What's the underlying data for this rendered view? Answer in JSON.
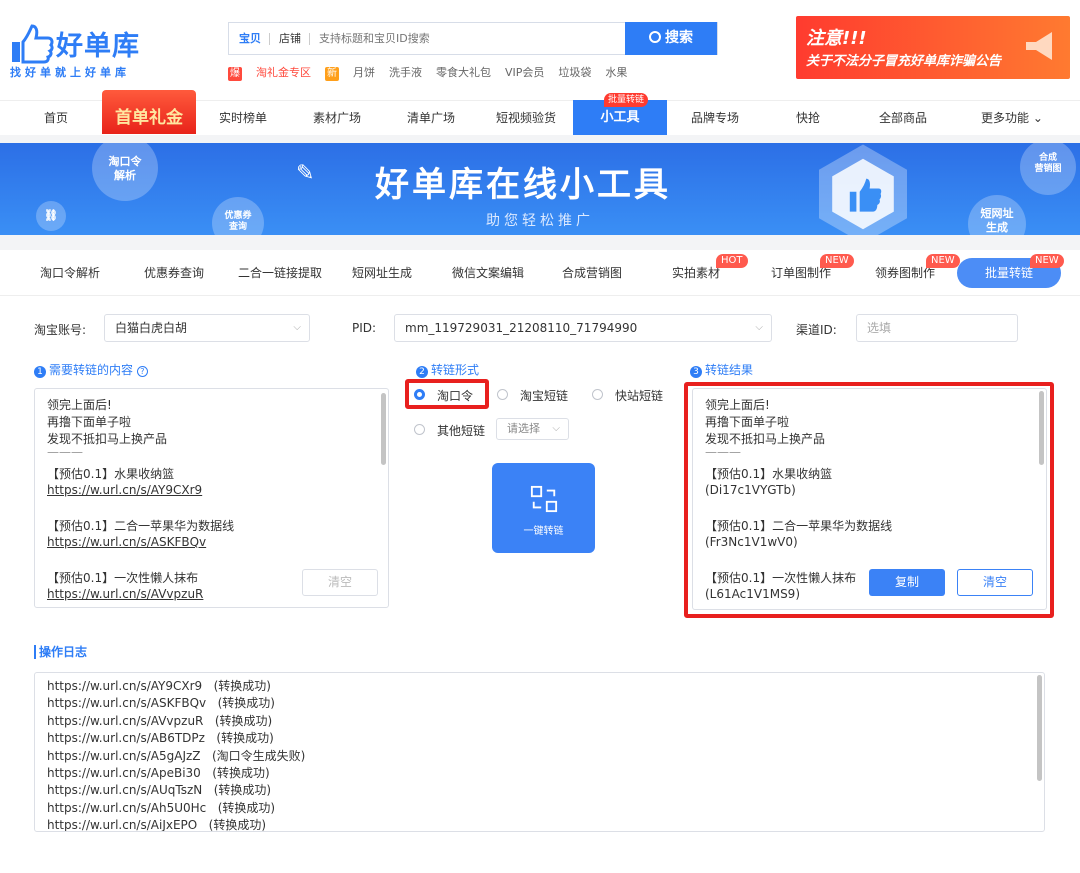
{
  "header": {
    "logo_name": "好单库",
    "logo_slogan": "找好单就上好单库",
    "search": {
      "tab_active": "宝贝",
      "tab_other": "店铺",
      "placeholder": "支持标题和宝贝ID搜索",
      "button": "搜索"
    },
    "hotwords": [
      {
        "tag": "爆",
        "text": "淘礼金专区",
        "tag_color": "#ff4a3d"
      },
      {
        "tag": "新",
        "text": "月饼",
        "tag_color": "#ff9f1a"
      },
      {
        "text": "洗手液"
      },
      {
        "text": "零食大礼包"
      },
      {
        "text": "VIP会员"
      },
      {
        "text": "垃圾袋"
      },
      {
        "text": "水果"
      }
    ],
    "notice": {
      "line1": "注意!!!",
      "line2": "关于不法分子冒充好单库诈骗公告"
    }
  },
  "nav": {
    "items": [
      "首页",
      "首单礼金",
      "实时榜单",
      "素材广场",
      "清单广场",
      "短视频验货",
      "小工具",
      "品牌专场",
      "快抢",
      "全部商品",
      "更多功能"
    ],
    "tools_badge": "批量转链"
  },
  "banner": {
    "title": "好单库在线小工具",
    "subtitle": "助您轻松推广",
    "bubbles": [
      "淘口令\n解析",
      "优惠券\n查询",
      "合成\n营销图",
      "短网址\n生成"
    ]
  },
  "tabs": [
    {
      "label": "淘口令解析"
    },
    {
      "label": "优惠券查询"
    },
    {
      "label": "二合一链接提取"
    },
    {
      "label": "短网址生成"
    },
    {
      "label": "微信文案编辑"
    },
    {
      "label": "合成营销图"
    },
    {
      "label": "实拍素材",
      "badge": "HOT"
    },
    {
      "label": "订单图制作",
      "badge": "NEW"
    },
    {
      "label": "领券图制作",
      "badge": "NEW"
    },
    {
      "label": "批量转链",
      "badge": "NEW"
    }
  ],
  "form": {
    "account_label": "淘宝账号:",
    "account_value": "白猫白虎白胡",
    "pid_label": "PID:",
    "pid_value": "mm_119729031_21208110_71794990",
    "channel_label": "渠道ID:",
    "channel_placeholder": "选填"
  },
  "sections": {
    "input": "需要转链的内容",
    "mode": "转链形式",
    "result": "转链结果"
  },
  "input_text": {
    "intro": [
      "领完上面后!",
      "再撸下面单子啦",
      "发现不抵扣马上换产品"
    ],
    "sep": "———",
    "items": [
      {
        "title": "【预估0.1】水果收纳篮",
        "link": "https://w.url.cn/s/AY9CXr9"
      },
      {
        "title": "【预估0.1】二合一苹果华为数据线",
        "link": "https://w.url.cn/s/ASKFBQv"
      },
      {
        "title": "【预估0.1】一次性懒人抹布",
        "link": "https://w.url.cn/s/AVvpzuR"
      }
    ],
    "clear": "清空"
  },
  "mode": {
    "options": [
      "淘口令",
      "淘宝短链",
      "快站短链",
      "其他短链"
    ],
    "select_placeholder": "请选择",
    "convert_button": "一键转链"
  },
  "result": {
    "intro": [
      "领完上面后!",
      "再撸下面单子啦",
      "发现不抵扣马上换产品"
    ],
    "sep": "———",
    "items": [
      {
        "title": "【预估0.1】水果收纳篮",
        "code": "(Di17c1VYGTb)"
      },
      {
        "title": "【预估0.1】二合一苹果华为数据线",
        "code": "(Fr3Nc1V1wV0)"
      },
      {
        "title": "【预估0.1】一次性懒人抹布",
        "code": "(L61Ac1V1MS9)"
      }
    ],
    "copy": "复制",
    "clear": "清空"
  },
  "log": {
    "title": "操作日志",
    "lines": [
      "https://w.url.cn/s/AY9CXr9   (转换成功)",
      "https://w.url.cn/s/ASKFBQv   (转换成功)",
      "https://w.url.cn/s/AVvpzuR   (转换成功)",
      "https://w.url.cn/s/AB6TDPz   (转换成功)",
      "https://w.url.cn/s/A5gAJzZ   (淘口令生成失败)",
      "https://w.url.cn/s/ApeBi30   (转换成功)",
      "https://w.url.cn/s/AUqTszN   (转换成功)",
      "https://w.url.cn/s/Ah5U0Hc   (转换成功)",
      "https://w.url.cn/s/AiJxEPO   (转换成功)"
    ]
  },
  "colors": {
    "brand": "#2e7df6",
    "highlight": "#e8201e",
    "badge": "#ff5a4e"
  }
}
